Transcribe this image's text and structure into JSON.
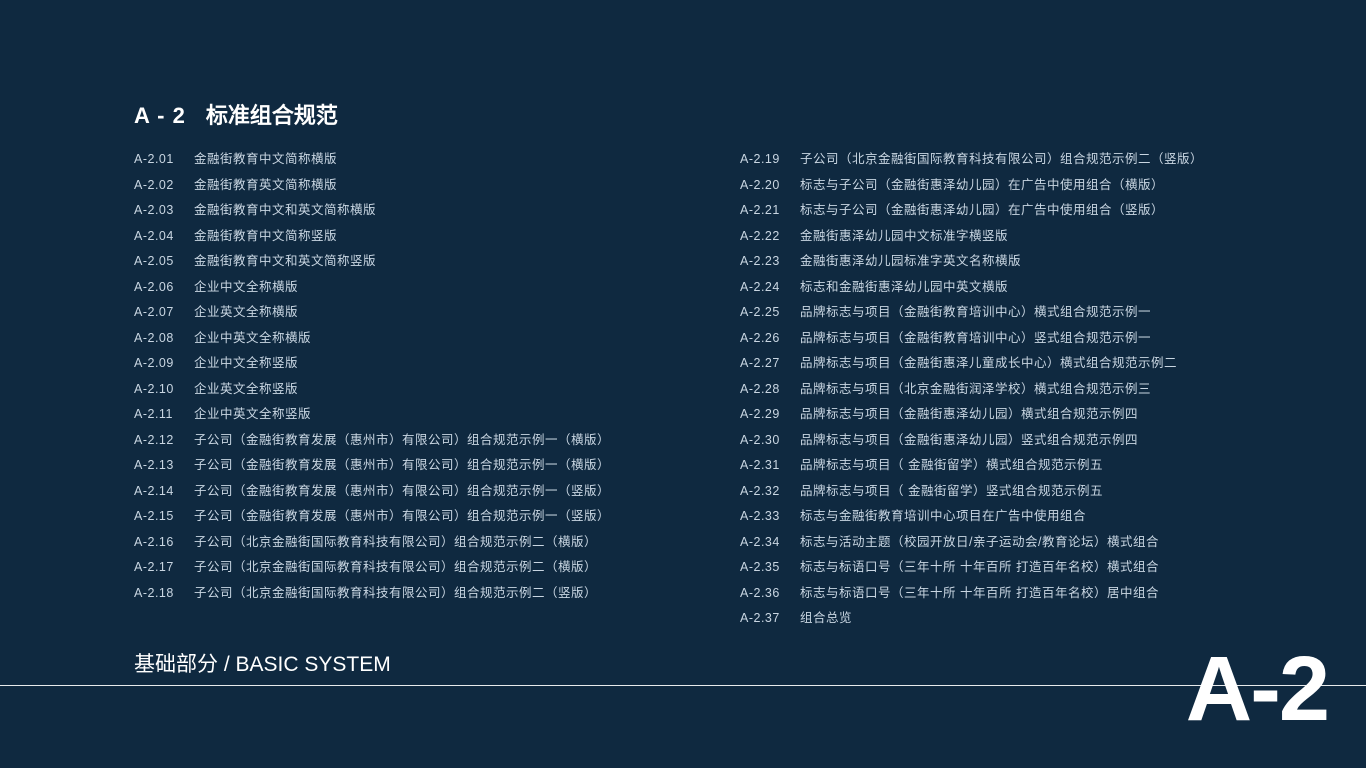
{
  "header": {
    "code": "A - 2",
    "title": "标准组合规范"
  },
  "left": [
    {
      "num": "A-2.01",
      "txt": "金融街教育中文简称横版"
    },
    {
      "num": "A-2.02",
      "txt": "金融街教育英文简称横版"
    },
    {
      "num": "A-2.03",
      "txt": "金融街教育中文和英文简称横版"
    },
    {
      "num": "A-2.04",
      "txt": "金融街教育中文简称竖版"
    },
    {
      "num": "A-2.05",
      "txt": "金融街教育中文和英文简称竖版"
    },
    {
      "num": "A-2.06",
      "txt": "企业中文全称横版"
    },
    {
      "num": "A-2.07",
      "txt": "企业英文全称横版"
    },
    {
      "num": "A-2.08",
      "txt": "企业中英文全称横版"
    },
    {
      "num": "A-2.09",
      "txt": "企业中文全称竖版"
    },
    {
      "num": "A-2.10",
      "txt": "企业英文全称竖版"
    },
    {
      "num": "A-2.11",
      "txt": "企业中英文全称竖版"
    },
    {
      "num": "A-2.12",
      "txt": "子公司（金融街教育发展（惠州市）有限公司）组合规范示例一（横版）"
    },
    {
      "num": "A-2.13",
      "txt": "子公司（金融街教育发展（惠州市）有限公司）组合规范示例一（横版）"
    },
    {
      "num": "A-2.14",
      "txt": "子公司（金融街教育发展（惠州市）有限公司）组合规范示例一（竖版）"
    },
    {
      "num": "A-2.15",
      "txt": "子公司（金融街教育发展（惠州市）有限公司）组合规范示例一（竖版）"
    },
    {
      "num": "A-2.16",
      "txt": "子公司（北京金融街国际教育科技有限公司）组合规范示例二（横版）"
    },
    {
      "num": "A-2.17",
      "txt": "子公司（北京金融街国际教育科技有限公司）组合规范示例二（横版）"
    },
    {
      "num": "A-2.18",
      "txt": "子公司（北京金融街国际教育科技有限公司）组合规范示例二（竖版）"
    }
  ],
  "right": [
    {
      "num": "A-2.19",
      "txt": "子公司（北京金融街国际教育科技有限公司）组合规范示例二（竖版）"
    },
    {
      "num": "A-2.20",
      "txt": "标志与子公司（金融街惠泽幼儿园）在广告中使用组合（横版）"
    },
    {
      "num": "A-2.21",
      "txt": "标志与子公司（金融街惠泽幼儿园）在广告中使用组合（竖版）"
    },
    {
      "num": "A-2.22",
      "txt": "金融街惠泽幼儿园中文标准字横竖版"
    },
    {
      "num": "A-2.23",
      "txt": "金融街惠泽幼儿园标准字英文名称横版"
    },
    {
      "num": "A-2.24",
      "txt": "标志和金融街惠泽幼儿园中英文横版"
    },
    {
      "num": "A-2.25",
      "txt": "品牌标志与项目（金融街教育培训中心）横式组合规范示例一"
    },
    {
      "num": "A-2.26",
      "txt": "品牌标志与项目（金融街教育培训中心）竖式组合规范示例一"
    },
    {
      "num": "A-2.27",
      "txt": "品牌标志与项目（金融街惠泽儿童成长中心）横式组合规范示例二"
    },
    {
      "num": "A-2.28",
      "txt": "品牌标志与项目（北京金融街润泽学校）横式组合规范示例三"
    },
    {
      "num": "A-2.29",
      "txt": "品牌标志与项目（金融街惠泽幼儿园）横式组合规范示例四"
    },
    {
      "num": "A-2.30",
      "txt": "品牌标志与项目（金融街惠泽幼儿园）竖式组合规范示例四"
    },
    {
      "num": "A-2.31",
      "txt": "品牌标志与项目（ 金融街留学）横式组合规范示例五"
    },
    {
      "num": "A-2.32",
      "txt": "品牌标志与项目（ 金融街留学）竖式组合规范示例五"
    },
    {
      "num": "A-2.33",
      "txt": "标志与金融街教育培训中心项目在广告中使用组合"
    },
    {
      "num": "A-2.34",
      "txt": "标志与活动主题（校园开放日/亲子运动会/教育论坛）横式组合"
    },
    {
      "num": "A-2.35",
      "txt": "标志与标语口号（三年十所 十年百所 打造百年名校）横式组合"
    },
    {
      "num": "A-2.36",
      "txt": "标志与标语口号（三年十所 十年百所 打造百年名校）居中组合"
    },
    {
      "num": "A-2.37",
      "txt": "组合总览"
    }
  ],
  "footer": {
    "label": "基础部分 / BASIC SYSTEM",
    "bigCode": "A-2"
  }
}
